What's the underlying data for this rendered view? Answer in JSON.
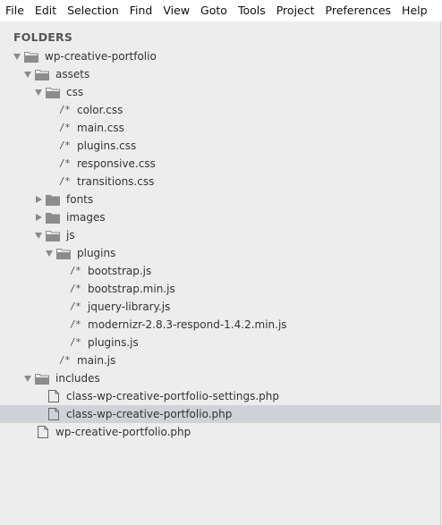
{
  "menubar": {
    "items": [
      "File",
      "Edit",
      "Selection",
      "Find",
      "View",
      "Goto",
      "Tools",
      "Project",
      "Preferences",
      "Help"
    ]
  },
  "sidebar": {
    "header": "FOLDERS",
    "file_icon_glyph": "/*",
    "tree": [
      {
        "label": "wp-creative-portfolio",
        "type": "folder",
        "state": "open",
        "depth": 0
      },
      {
        "label": "assets",
        "type": "folder",
        "state": "open",
        "depth": 1
      },
      {
        "label": "css",
        "type": "folder",
        "state": "open",
        "depth": 2
      },
      {
        "label": "color.css",
        "type": "code-file",
        "depth": 3
      },
      {
        "label": "main.css",
        "type": "code-file",
        "depth": 3
      },
      {
        "label": "plugins.css",
        "type": "code-file",
        "depth": 3
      },
      {
        "label": "responsive.css",
        "type": "code-file",
        "depth": 3
      },
      {
        "label": "transitions.css",
        "type": "code-file",
        "depth": 3
      },
      {
        "label": "fonts",
        "type": "folder",
        "state": "closed",
        "depth": 2
      },
      {
        "label": "images",
        "type": "folder",
        "state": "closed",
        "depth": 2
      },
      {
        "label": "js",
        "type": "folder",
        "state": "open",
        "depth": 2
      },
      {
        "label": "plugins",
        "type": "folder",
        "state": "open",
        "depth": 3
      },
      {
        "label": "bootstrap.js",
        "type": "code-file",
        "depth": 4
      },
      {
        "label": "bootstrap.min.js",
        "type": "code-file",
        "depth": 4
      },
      {
        "label": "jquery-library.js",
        "type": "code-file",
        "depth": 4
      },
      {
        "label": "modernizr-2.8.3-respond-1.4.2.min.js",
        "type": "code-file",
        "depth": 4
      },
      {
        "label": "plugins.js",
        "type": "code-file",
        "depth": 4
      },
      {
        "label": "main.js",
        "type": "code-file",
        "depth": 3
      },
      {
        "label": "includes",
        "type": "folder",
        "state": "open",
        "depth": 1
      },
      {
        "label": "class-wp-creative-portfolio-settings.php",
        "type": "page-file",
        "depth": 2
      },
      {
        "label": "class-wp-creative-portfolio.php",
        "type": "page-file",
        "depth": 2,
        "selected": true
      },
      {
        "label": "wp-creative-portfolio.php",
        "type": "page-file",
        "depth": 1
      }
    ]
  },
  "colors": {
    "sidebar_bg": "#ededed",
    "selected_row": "#cfd2d6",
    "folder_icon": "#8c8c8c",
    "arrow": "#8a8a8a",
    "text": "#333333"
  }
}
